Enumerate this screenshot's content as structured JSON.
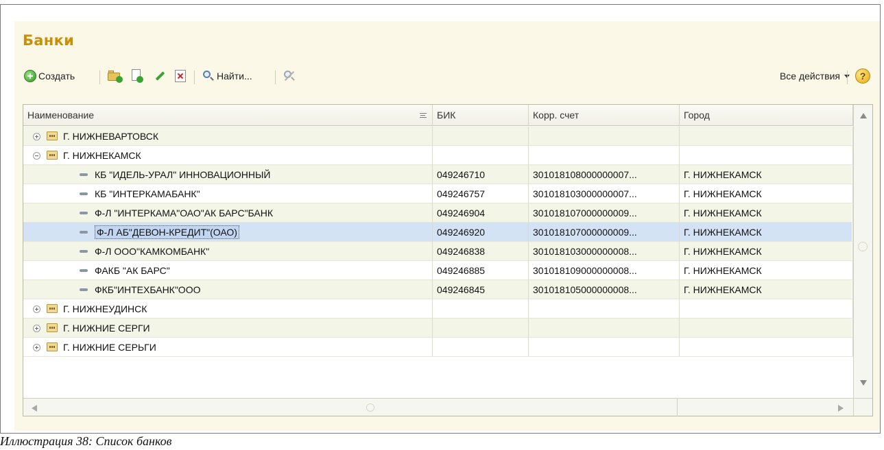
{
  "window": {
    "title": "Банки"
  },
  "toolbar": {
    "create_label": "Создать",
    "find_label": "Найти...",
    "all_actions_label": "Все действия",
    "help_label": "?"
  },
  "table": {
    "columns": [
      "Наименование",
      "БИК",
      "Корр. счет",
      "Город"
    ],
    "rows": [
      {
        "type": "group",
        "expanded": false,
        "name": "Г. НИЖНЕВАРТОВСК",
        "bik": "",
        "account": "",
        "city": ""
      },
      {
        "type": "group",
        "expanded": true,
        "name": "Г. НИЖНЕКАМСК",
        "bik": "",
        "account": "",
        "city": ""
      },
      {
        "type": "item",
        "name": "КБ \"ИДЕЛЬ-УРАЛ\" ИННОВАЦИОННЫЙ",
        "bik": "049246710",
        "account": "301018108000000007...",
        "city": "Г. НИЖНЕКАМСК"
      },
      {
        "type": "item",
        "name": "КБ \"ИНТЕРКАМАБАНК\"",
        "bik": "049246757",
        "account": "301018103000000007...",
        "city": "Г. НИЖНЕКАМСК"
      },
      {
        "type": "item",
        "name": "Ф-Л \"ИНТЕРКАМА\"ОАО\"АК БАРС\"БАНК",
        "bik": "049246904",
        "account": "301018107000000009...",
        "city": "Г. НИЖНЕКАМСК"
      },
      {
        "type": "item",
        "selected": true,
        "name": "Ф-Л АБ\"ДЕВОН-КРЕДИТ\"(ОАО)",
        "bik": "049246920",
        "account": "301018107000000009...",
        "city": "Г. НИЖНЕКАМСК"
      },
      {
        "type": "item",
        "name": "Ф-Л ООО\"КАМКОМБАНК\"",
        "bik": "049246838",
        "account": "301018103000000008...",
        "city": "Г. НИЖНЕКАМСК"
      },
      {
        "type": "item",
        "name": "ФАКБ \"АК БАРС\"",
        "bik": "049246885",
        "account": "301018109000000008...",
        "city": "Г. НИЖНЕКАМСК"
      },
      {
        "type": "item",
        "name": "ФКБ\"ИНТЕХБАНК\"ООО",
        "bik": "049246845",
        "account": "301018105000000008...",
        "city": "Г. НИЖНЕКАМСК"
      },
      {
        "type": "group",
        "expanded": false,
        "name": "Г. НИЖНЕУДИНСК",
        "bik": "",
        "account": "",
        "city": ""
      },
      {
        "type": "group",
        "expanded": false,
        "name": "Г. НИЖНИЕ СЕРГИ",
        "bik": "",
        "account": "",
        "city": ""
      },
      {
        "type": "group",
        "expanded": false,
        "name": "Г. НИЖНИЕ СЕРЬГИ",
        "bik": "",
        "account": "",
        "city": ""
      }
    ]
  },
  "caption": "Иллюстрация 38: Список банков",
  "colors": {
    "title": "#c8900a",
    "window_bg": "#fbf8e8",
    "row_alt": "#f3f5e6",
    "row_selected": "#d4e2f6"
  },
  "icons": {
    "create": "green-plus-circle-icon",
    "add_folder": "folder-plus-icon",
    "copy": "document-plus-icon",
    "edit": "pencil-icon",
    "delete": "delete-icon",
    "find": "magnifier-icon",
    "cancel_find": "magnifier-cancel-icon",
    "help": "help-icon",
    "group": "group-folder-icon",
    "item": "item-dash-icon"
  }
}
